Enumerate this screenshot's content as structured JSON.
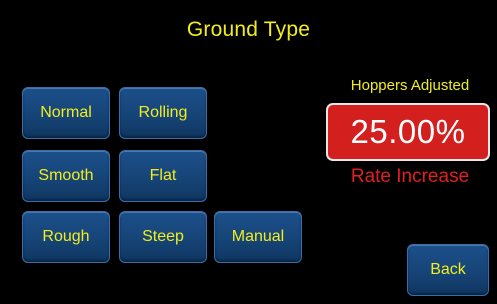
{
  "header": {
    "title": "Ground Type"
  },
  "ground_types": {
    "normal": "Normal",
    "rolling": "Rolling",
    "smooth": "Smooth",
    "flat": "Flat",
    "rough": "Rough",
    "steep": "Steep",
    "manual": "Manual"
  },
  "status": {
    "hoppers_label": "Hoppers Adjusted",
    "rate_value": "25.00%",
    "rate_caption": "Rate Increase"
  },
  "nav": {
    "back_label": "Back"
  },
  "colors": {
    "background": "#000000",
    "label_text": "#f2ee1e",
    "button_fill": "#164477",
    "rate_box_fill": "#d41f1f",
    "rate_caption": "#e02020"
  }
}
